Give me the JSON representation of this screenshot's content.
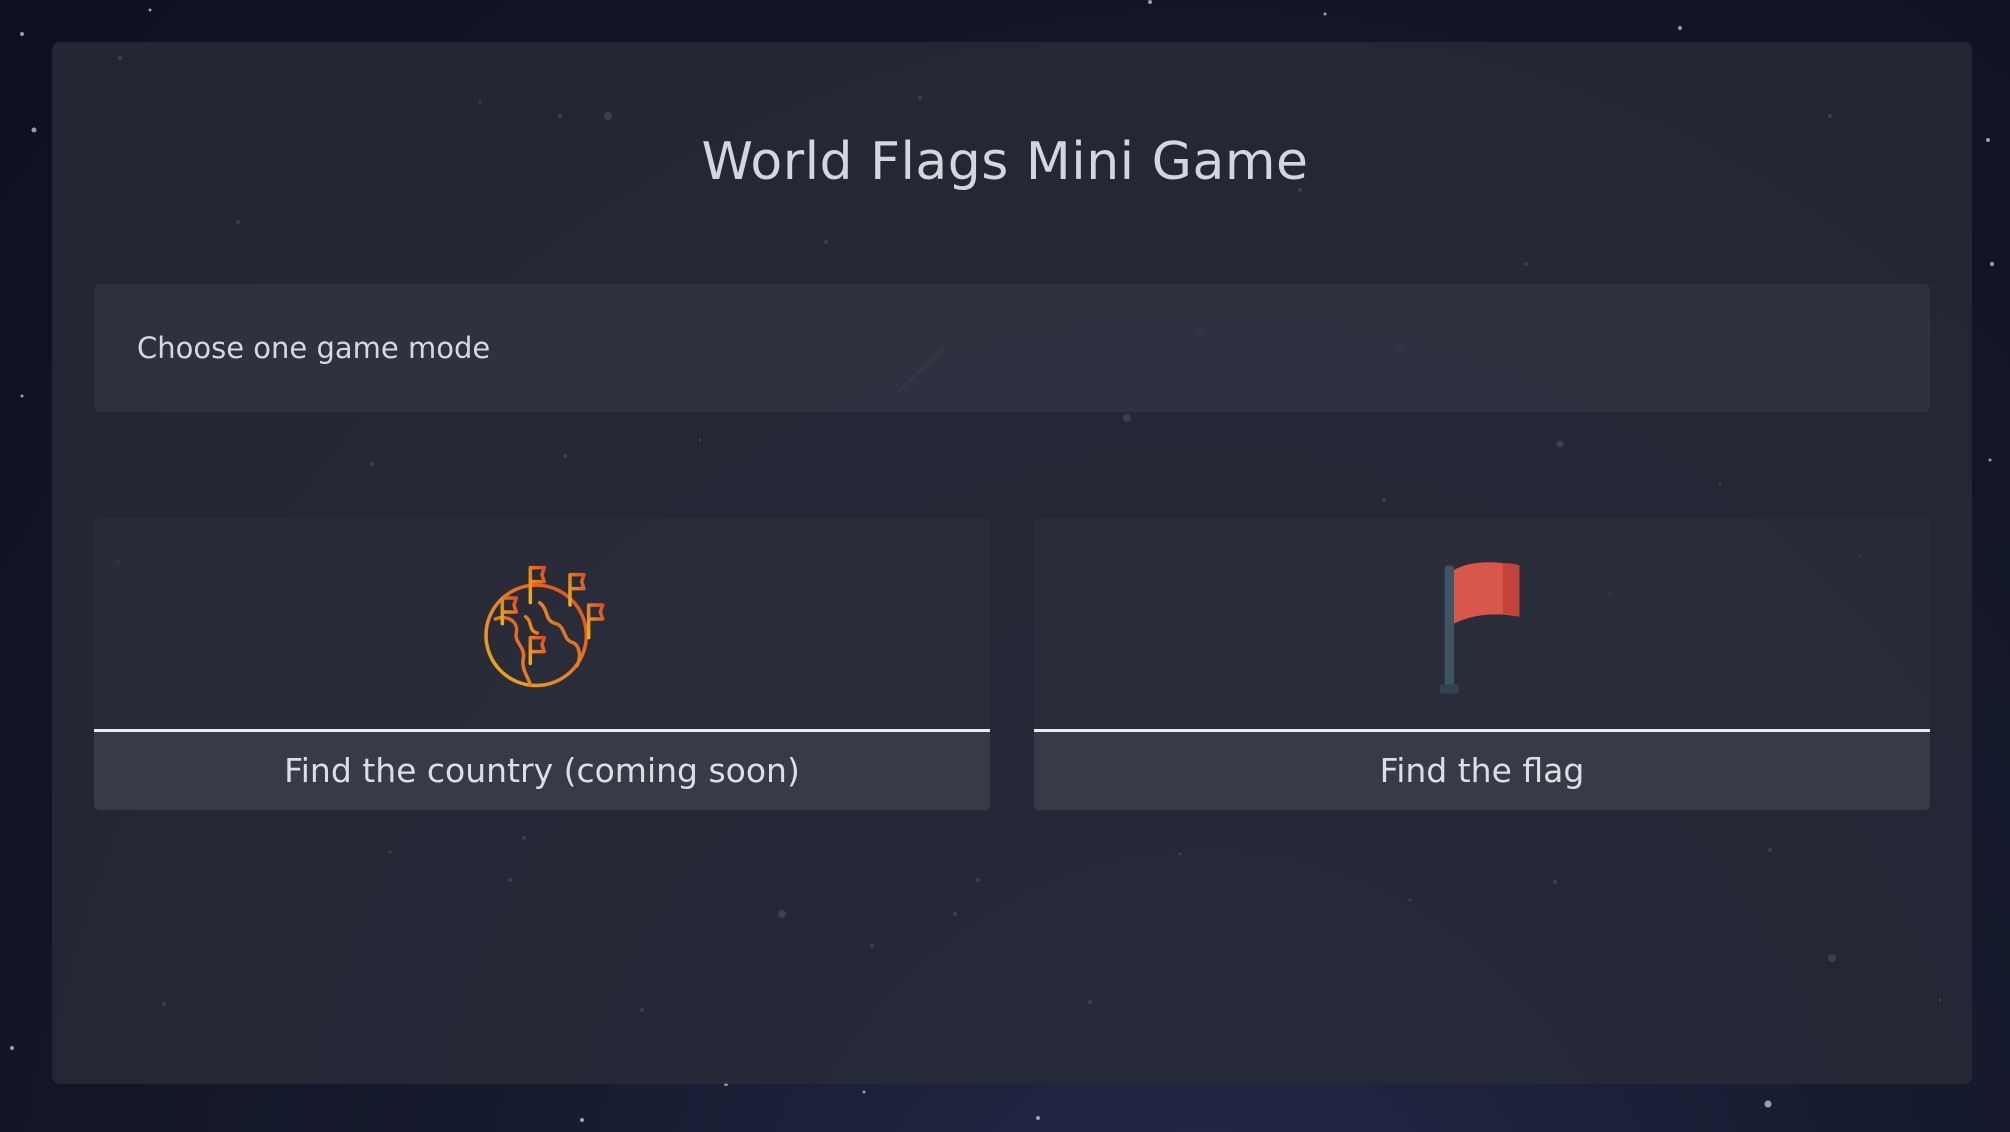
{
  "title": "World Flags Mini Game",
  "subheader": {
    "text": "Choose one game mode"
  },
  "modes": [
    {
      "label": "Find the country  (coming soon)",
      "icon": "globe-with-flags-icon",
      "available": false
    },
    {
      "label": "Find the flag",
      "icon": "red-flag-icon",
      "available": true
    }
  ],
  "colors": {
    "background": "#161a2e",
    "panel": "#282b37",
    "card_label_bar": "#373b47",
    "flag_red": "#d9574a",
    "globe_orange": "#e8a21c",
    "text": "#d3d6dc"
  }
}
